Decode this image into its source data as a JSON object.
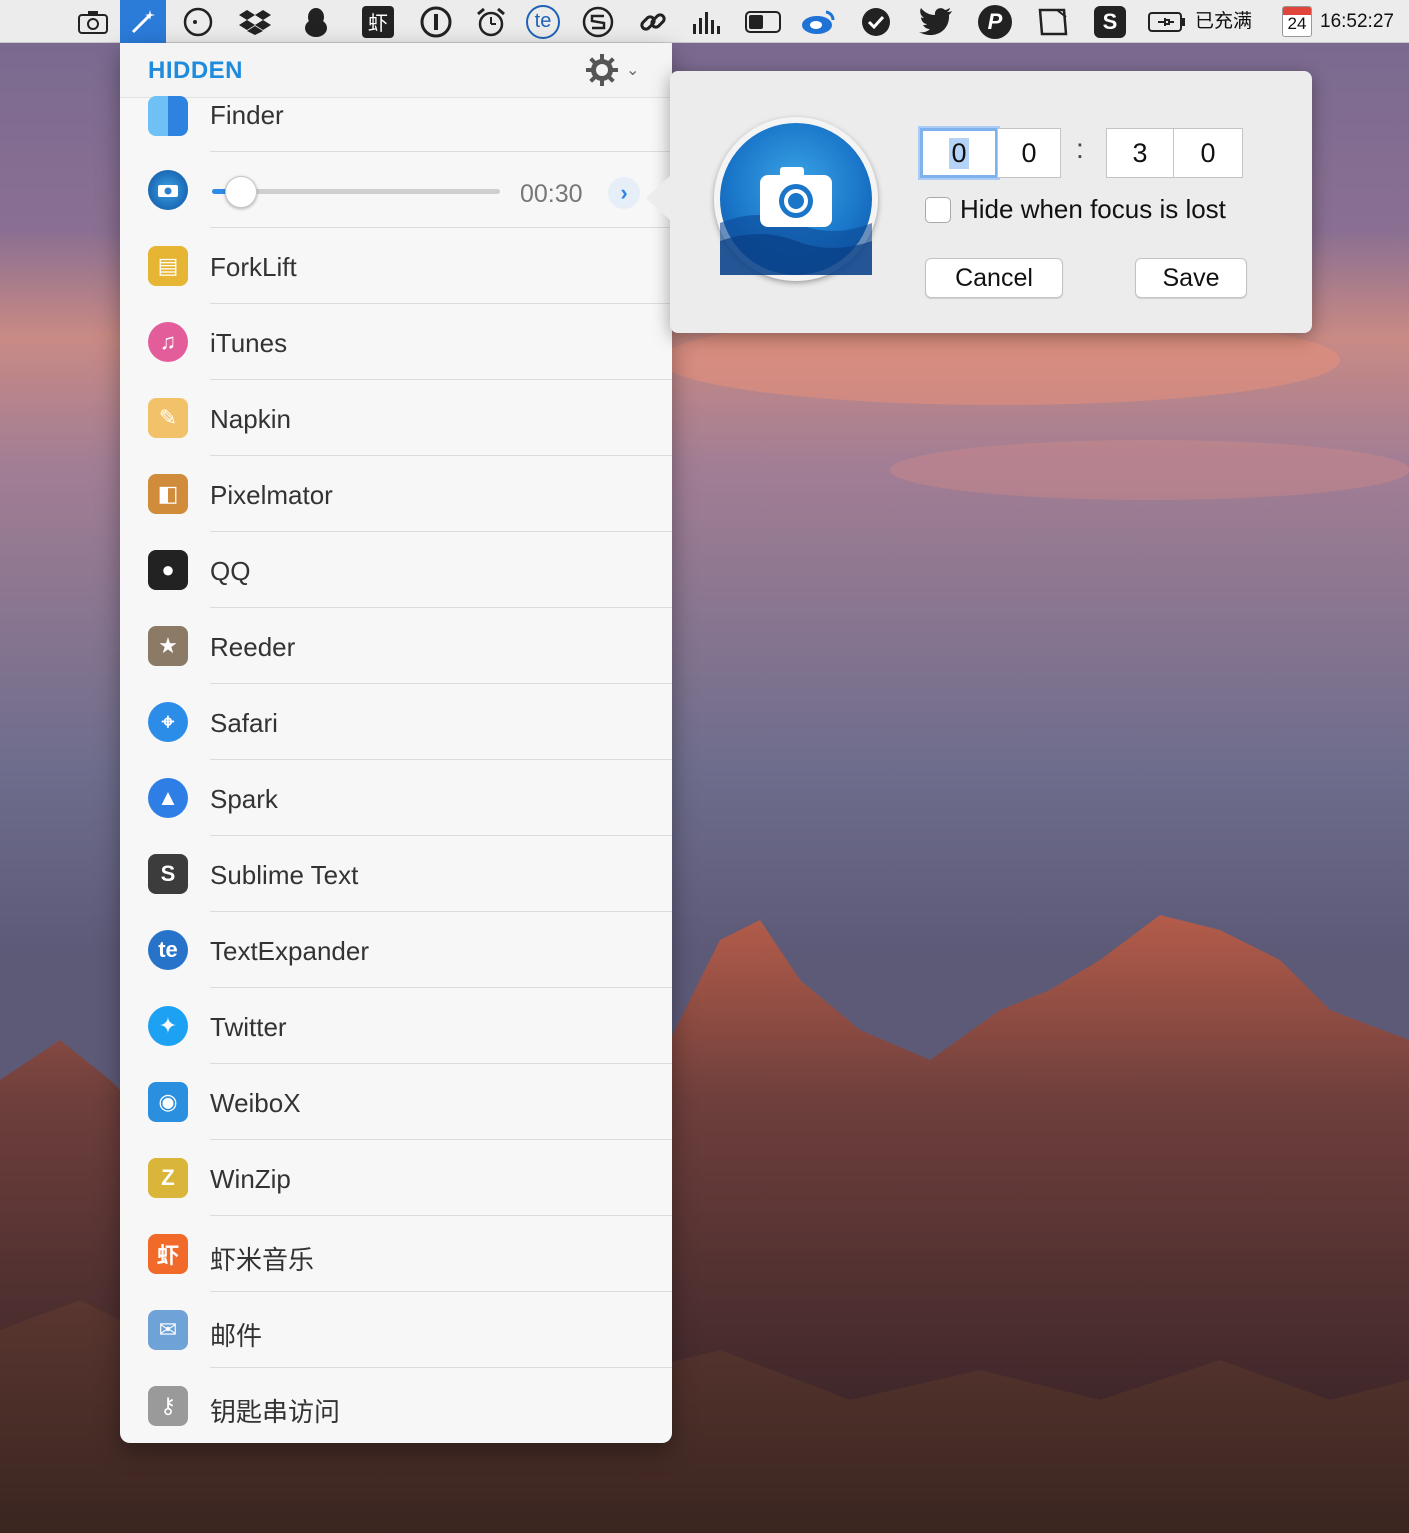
{
  "menubar": {
    "icons": [
      "camera-icon",
      "magic-wand-icon",
      "circle-dot-icon",
      "dropbox-icon",
      "qq-penguin-icon",
      "xiami-icon",
      "info-icon",
      "alarm-clock-icon",
      "textexpander-icon",
      "s-circle-icon",
      "link-icon",
      "audio-levels-icon",
      "toggle-icon",
      "weibo-icon",
      "check-badge-icon",
      "twitter-icon",
      "p-circle-icon",
      "document-icon",
      "sublime-icon",
      "battery-icon",
      "calendar-icon"
    ],
    "battery_text": "已充满",
    "calendar_day": "24",
    "clock": "16:52:27"
  },
  "panel": {
    "title": "HIDDEN",
    "settings_icon": "gear-icon",
    "apps": [
      {
        "name": "Finder",
        "icon": "finder-icon",
        "color": "#3b8ee6"
      },
      {
        "name": "ForkLift",
        "icon": "forklift-icon",
        "color": "#e6b533"
      },
      {
        "name": "iTunes",
        "icon": "itunes-icon",
        "color": "#e35d9a"
      },
      {
        "name": "Napkin",
        "icon": "napkin-icon",
        "color": "#f2c26b"
      },
      {
        "name": "Pixelmator",
        "icon": "pixelmator-icon",
        "color": "#d08b3b"
      },
      {
        "name": "QQ",
        "icon": "qq-icon",
        "color": "#222222"
      },
      {
        "name": "Reeder",
        "icon": "reeder-icon",
        "color": "#8a7a66"
      },
      {
        "name": "Safari",
        "icon": "safari-icon",
        "color": "#2c8de8"
      },
      {
        "name": "Spark",
        "icon": "spark-icon",
        "color": "#2f7ee6"
      },
      {
        "name": "Sublime Text",
        "icon": "sublime-text-icon",
        "color": "#3c3c3c"
      },
      {
        "name": "TextExpander",
        "icon": "textexpander-icon",
        "color": "#2673c9"
      },
      {
        "name": "Twitter",
        "icon": "twitter-icon",
        "color": "#1da1f2"
      },
      {
        "name": "WeiboX",
        "icon": "weibox-icon",
        "color": "#2b8fe0"
      },
      {
        "name": "WinZip",
        "icon": "winzip-icon",
        "color": "#d9b53a"
      },
      {
        "name": "虾米音乐",
        "icon": "xiami-music-icon",
        "color": "#f26a2a"
      },
      {
        "name": "邮件",
        "icon": "mail-icon",
        "color": "#6fa3d8"
      },
      {
        "name": "钥匙串访问",
        "icon": "keychain-icon",
        "color": "#9a9a9a"
      }
    ],
    "timer_row": {
      "icon": "screenshot-camera-icon",
      "time": "00:30",
      "slider_fraction": 0.1
    }
  },
  "popover": {
    "icon": "screenshot-camera-icon",
    "digits": [
      "0",
      "0",
      "3",
      "0"
    ],
    "colon": ":",
    "hide_label": "Hide when focus is lost",
    "hide_checked": false,
    "cancel_label": "Cancel",
    "save_label": "Save"
  }
}
